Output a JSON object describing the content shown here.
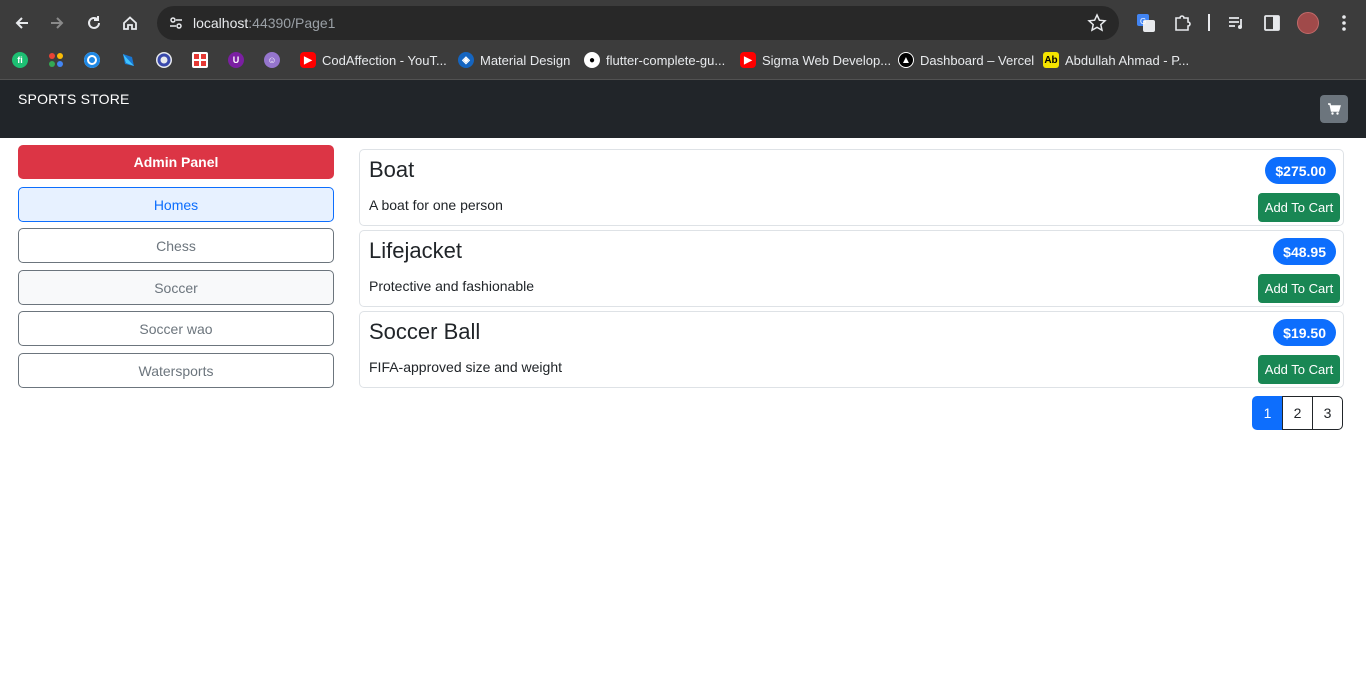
{
  "browser": {
    "url_host": "localhost",
    "url_rest": ":44390/Page1",
    "bookmarks": [
      {
        "label": "",
        "icon": "fiverr-icon",
        "color": "#1dbf73"
      },
      {
        "label": "",
        "icon": "dots-app-icon",
        "color": "#3c3c3c"
      },
      {
        "label": "",
        "icon": "c-app-icon",
        "color": "#1e88e5"
      },
      {
        "label": "",
        "icon": "dart-icon",
        "color": "#1976d2"
      },
      {
        "label": "",
        "icon": "ring-icon",
        "color": "#3949ab"
      },
      {
        "label": "",
        "icon": "grid-app-icon",
        "color": "#e53935"
      },
      {
        "label": "",
        "icon": "u-app-icon",
        "color": "#7b1fa2"
      },
      {
        "label": "",
        "icon": "avatar-app-icon",
        "color": "#9575cd"
      },
      {
        "label": "CodAffection - YouT...",
        "icon": "youtube-icon",
        "color": "#ff0000"
      },
      {
        "label": "Material Design",
        "icon": "material-icon",
        "color": "#1565c0"
      },
      {
        "label": "flutter-complete-gu...",
        "icon": "github-icon",
        "color": "#ffffff"
      },
      {
        "label": "Sigma Web Develop...",
        "icon": "youtube-icon",
        "color": "#ff0000"
      },
      {
        "label": "Dashboard – Vercel",
        "icon": "vercel-icon",
        "color": "#000000"
      },
      {
        "label": "Abdullah Ahmad - P...",
        "icon": "ab-app-icon",
        "color": "#f5e400"
      }
    ]
  },
  "navbar": {
    "brand": "SPORTS STORE"
  },
  "sidebar": {
    "admin_label": "Admin Panel",
    "categories": [
      {
        "label": "Homes",
        "state": "active"
      },
      {
        "label": "Chess",
        "state": "normal"
      },
      {
        "label": "Soccer",
        "state": "hover"
      },
      {
        "label": "Soccer wao",
        "state": "normal"
      },
      {
        "label": "Watersports",
        "state": "normal"
      }
    ]
  },
  "products": [
    {
      "name": "Boat",
      "description": "A boat for one person",
      "price": "$275.00",
      "button": "Add To Cart"
    },
    {
      "name": "Lifejacket",
      "description": "Protective and fashionable",
      "price": "$48.95",
      "button": "Add To Cart"
    },
    {
      "name": "Soccer Ball",
      "description": "FIFA-approved size and weight",
      "price": "$19.50",
      "button": "Add To Cart"
    }
  ],
  "pagination": {
    "pages": [
      "1",
      "2",
      "3"
    ],
    "current": "1"
  },
  "colors": {
    "primary": "#0d6efd",
    "danger": "#dc3545",
    "success": "#198754",
    "dark": "#212529",
    "secondary": "#6c757d"
  }
}
